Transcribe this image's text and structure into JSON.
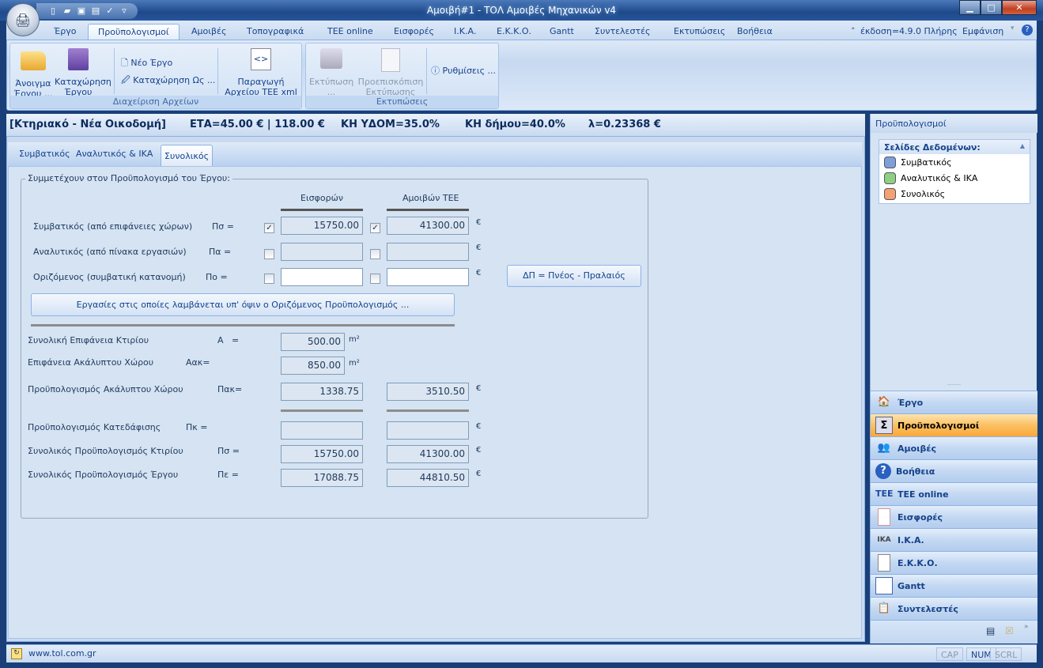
{
  "window": {
    "title": "Αμοιβή#1 - ΤΟΛ Αμοιβές Μηχανικών v4"
  },
  "ribbon_tabs": [
    "Έργο",
    "Προϋπολογισμοί",
    "Αμοιβές",
    "Τοπογραφικά",
    "TEE online",
    "Εισφορές",
    "Ι.Κ.Α.",
    "Ε.Κ.Κ.Ο.",
    "Gantt",
    "Συντελεστές",
    "Εκτυπώσεις",
    "Βοήθεια"
  ],
  "active_ribbon_tab": "Προϋπολογισμοί",
  "ribbon_right": {
    "version": "έκδοση=4.9.0 Πλήρης",
    "appearance": "Εμφάνιση"
  },
  "ribbon": {
    "files_group": "Διαχείριση Αρχείων",
    "open": "Άνοιγμα Έργου ...",
    "save": "Καταχώρηση Έργου",
    "new": "Νέο Έργο",
    "save_as": "Καταχώρηση Ως ...",
    "export": "Παραγωγή Αρχείου TEE xml ...",
    "print_group": "Εκτυπώσεις",
    "print": "Εκτύπωση ...",
    "preview": "Προεπισκόπιση Εκτύπωσης",
    "settings": "Ρυθμίσεις ..."
  },
  "infobar": {
    "project": "[Κτηριακό - Νέα Οικοδομή]",
    "eta": "ΕΤΑ=45.00 € | 118.00 €",
    "kh_ydom": "ΚΗ ΥΔΟΜ=35.0%",
    "kh_dimou": "ΚΗ δήμου=40.0%",
    "lambda": "λ=0.23368 €"
  },
  "page_tabs": [
    "Συμβατικός",
    "Αναλυτικός & ΙΚΑ",
    "Συνολικός"
  ],
  "active_page_tab": "Συνολικός",
  "form": {
    "legend": "Συμμετέχουν στον Προϋπολογισμό του Έργου:",
    "col1": "Εισφορών",
    "col2": "Αμοιβών ΤΕΕ",
    "euro": "€",
    "m2": "m²",
    "rows": [
      {
        "label": "Συμβατικός (από επιφάνειες χώρων)",
        "sym": "Πσ =",
        "check1": true,
        "v1": "15750.00",
        "check2": true,
        "v2": "41300.00"
      },
      {
        "label": "Αναλυτικός (από πίνακα εργασιών)",
        "sym": "Πα =",
        "check1": false,
        "v1": "",
        "check2": false,
        "v2": ""
      },
      {
        "label": "Οριζόμενος (συμβατική κατανομή)",
        "sym": "Πο =",
        "check1": false,
        "v1": "",
        "check2": false,
        "v2": ""
      }
    ],
    "dp_button": "ΔΠ = Πνέος - Πpαλαιός",
    "works_button": "Εργασίες στις οποίες λαμβάνεται υπ' όψιν ο Οριζόμενος Προϋπολογισμός ...",
    "area_label": "Συνολική Επιφάνεια Κτιρίου",
    "area_sym": "Α   =",
    "area": "500.00",
    "open_area_label": "Επιφάνεια Ακάλυπτου Χώρου",
    "open_area_sym": "Αακ=",
    "open_area": "850.00",
    "open_budget_label": "Προϋπολογισμός Ακάλυπτου Χώρου",
    "open_budget_sym": "Πακ=",
    "open_budget1": "1338.75",
    "open_budget2": "3510.50",
    "demo_label": "Προϋπολογισμός Κατεδάφισης",
    "demo_sym": "Πκ =",
    "demo1": "",
    "demo2": "",
    "building_label": "Συνολικός Προϋπολογισμός Κτιρίου",
    "building_sym": "Πσ =",
    "building1": "15750.00",
    "building2": "41300.00",
    "project_label": "Συνολικός Προϋπολογισμός Έργου",
    "project_sym": "Πε =",
    "project1": "17088.75",
    "project2": "44810.50"
  },
  "right_panel": {
    "title": "Προϋπολογισμοί",
    "pages_title": "Σελίδες Δεδομένων:",
    "pages": [
      {
        "label": "Συμβατικός",
        "color": "#7f9fd8"
      },
      {
        "label": "Αναλυτικός & ΙΚΑ",
        "color": "#8fd080"
      },
      {
        "label": "Συνολικός",
        "color": "#f5a070"
      }
    ],
    "nav": [
      {
        "label": "Έργο",
        "icon": "house-icon"
      },
      {
        "label": "Προϋπολογισμοί",
        "icon": "sigma-icon"
      },
      {
        "label": "Αμοιβές",
        "icon": "users-icon"
      },
      {
        "label": "Βοήθεια",
        "icon": "help-icon"
      },
      {
        "label": "TEE online",
        "icon": "tee-icon"
      },
      {
        "label": "Εισφορές",
        "icon": "document-icon"
      },
      {
        "label": "Ι.Κ.Α.",
        "icon": "ika-icon"
      },
      {
        "label": "Ε.Κ.Κ.Ο.",
        "icon": "list-icon"
      },
      {
        "label": "Gantt",
        "icon": "gantt-icon"
      },
      {
        "label": "Συντελεστές",
        "icon": "coefficients-icon"
      }
    ],
    "active_nav": "Προϋπολογισμοί"
  },
  "statusbar": {
    "url": "www.tol.com.gr",
    "cap": "CAP",
    "num": "NUM",
    "scrl": "SCRL"
  }
}
